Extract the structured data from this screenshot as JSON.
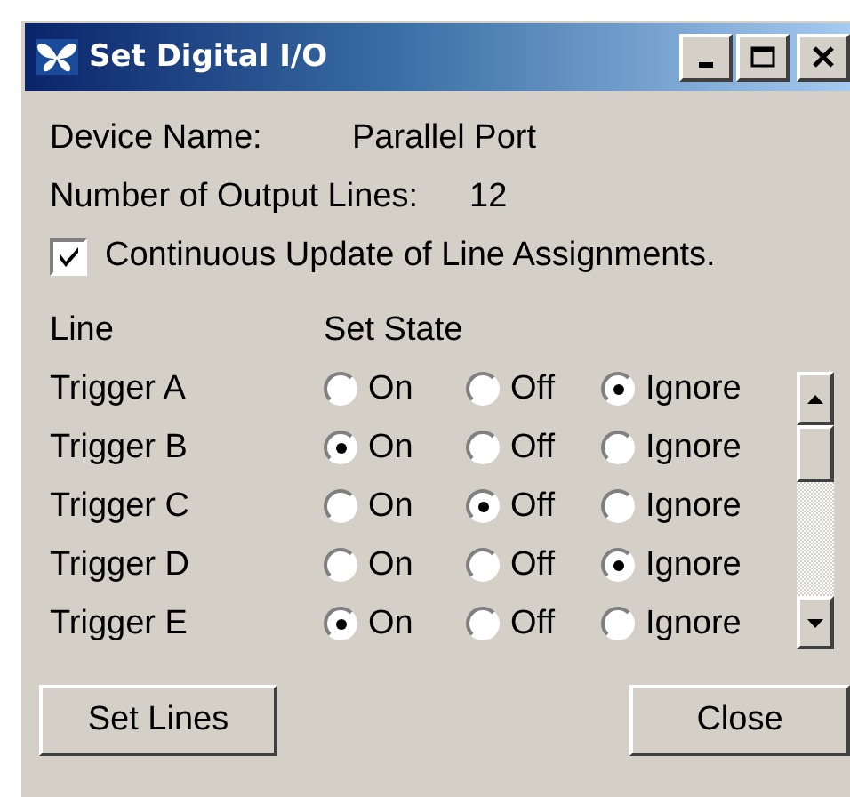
{
  "window": {
    "title": "Set Digital I/O"
  },
  "device": {
    "label": "Device Name:",
    "value": "Parallel Port"
  },
  "output_lines": {
    "label": "Number of Output Lines:",
    "value": "12"
  },
  "continuous_update": {
    "label": "Continuous Update of Line Assignments.",
    "checked": true
  },
  "columns": [
    "Line",
    "Set State"
  ],
  "lines": [
    {
      "name": "Trigger A",
      "options": [
        {
          "label": "On",
          "selected": false
        },
        {
          "label": "Off",
          "selected": false
        },
        {
          "label": "Ignore",
          "selected": true
        }
      ]
    },
    {
      "name": "Trigger B",
      "options": [
        {
          "label": "On",
          "selected": true
        },
        {
          "label": "Off",
          "selected": false
        },
        {
          "label": "Ignore",
          "selected": false
        }
      ]
    },
    {
      "name": "Trigger C",
      "options": [
        {
          "label": "On",
          "selected": false
        },
        {
          "label": "Off",
          "selected": true
        },
        {
          "label": "Ignore",
          "selected": false
        }
      ]
    },
    {
      "name": "Trigger D",
      "options": [
        {
          "label": "On",
          "selected": false
        },
        {
          "label": "Off",
          "selected": false
        },
        {
          "label": "Ignore",
          "selected": true
        }
      ]
    },
    {
      "name": "Trigger E",
      "options": [
        {
          "label": "On",
          "selected": true
        },
        {
          "label": "Off",
          "selected": false
        },
        {
          "label": "Ignore",
          "selected": false
        }
      ]
    }
  ],
  "buttons": [
    "Set Lines",
    "Close"
  ]
}
